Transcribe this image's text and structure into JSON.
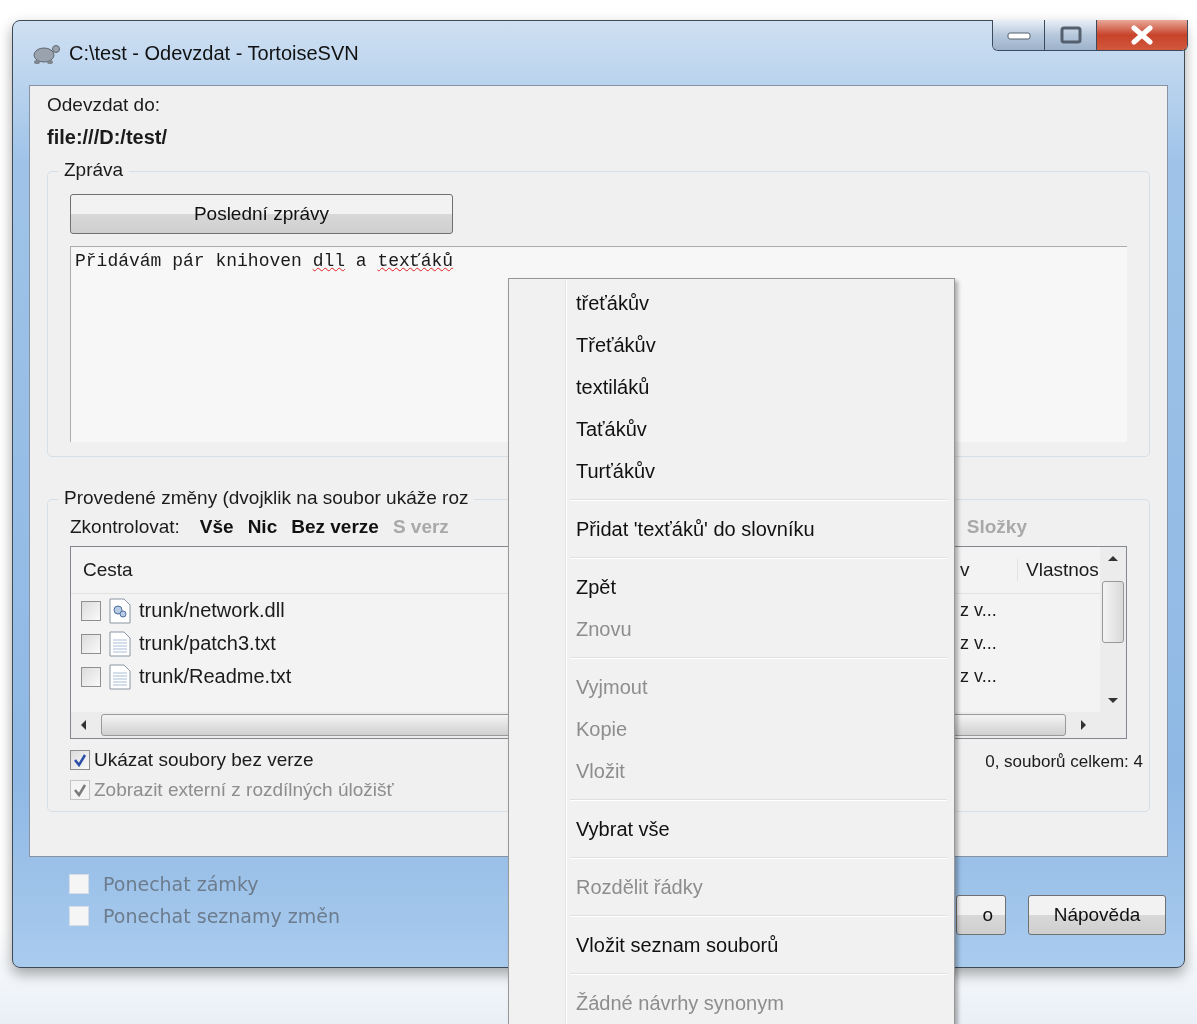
{
  "window": {
    "title": "C:\\test - Odevzdat - TortoiseSVN"
  },
  "commit_to": {
    "label": "Odevzdat do:",
    "url": "file:///D:/test/"
  },
  "message_group": {
    "title": "Zpráva",
    "recent_button": "Poslední zprávy",
    "message": [
      {
        "text": "Přidávám pár knihoven ",
        "misspelled": false
      },
      {
        "text": "dll",
        "misspelled": true
      },
      {
        "text": " a ",
        "misspelled": false
      },
      {
        "text": "texťáků",
        "misspelled": true
      }
    ]
  },
  "changes_group": {
    "title": "Provedené změny (dvojklik na soubor ukáže roz",
    "check_label": "Zkontrolovat:",
    "check_links": [
      {
        "label": "Vše",
        "disabled": false
      },
      {
        "label": "Nic",
        "disabled": false
      },
      {
        "label": "Bez verze",
        "disabled": false
      },
      {
        "label": "S verz",
        "disabled": true
      }
    ],
    "check_links_right": [
      {
        "label": "Složky",
        "disabled": true
      }
    ],
    "list": {
      "columns": [
        "Cesta"
      ],
      "columns_right": [
        "v",
        "Vlastnos"
      ],
      "rows": [
        {
          "path": "trunk/network.dll",
          "kind": "library",
          "checked": false,
          "column_2": "z v..."
        },
        {
          "path": "trunk/patch3.txt",
          "kind": "text",
          "checked": false,
          "column_2": "z v..."
        },
        {
          "path": "trunk/Readme.txt",
          "kind": "text",
          "checked": false,
          "column_2": "z v..."
        }
      ]
    },
    "options": [
      {
        "label": "Ukázat soubory bez verze",
        "checked": true,
        "disabled": false
      },
      {
        "label": "Zobrazit externí z rozdílných úložišť",
        "checked": true,
        "disabled": true
      }
    ],
    "status": "0, souborů celkem: 4"
  },
  "bottom_options": [
    {
      "label": "Ponechat zámky",
      "checked": false,
      "disabled": true
    },
    {
      "label": "Ponechat seznamy změn",
      "checked": false,
      "disabled": true
    }
  ],
  "buttons": [
    "o",
    "Nápověda"
  ],
  "context_menu": {
    "items": [
      {
        "kind": "item",
        "label": "třeťákův",
        "disabled": false
      },
      {
        "kind": "item",
        "label": "Třeťákův",
        "disabled": false
      },
      {
        "kind": "item",
        "label": "textiláků",
        "disabled": false
      },
      {
        "kind": "item",
        "label": "Taťákův",
        "disabled": false
      },
      {
        "kind": "item",
        "label": "Turťákův",
        "disabled": false
      },
      {
        "kind": "separator"
      },
      {
        "kind": "item",
        "label": "Přidat 'texťáků' do slovníku",
        "disabled": false
      },
      {
        "kind": "separator"
      },
      {
        "kind": "item",
        "label": "Zpět",
        "disabled": false
      },
      {
        "kind": "item",
        "label": "Znovu",
        "disabled": true
      },
      {
        "kind": "separator"
      },
      {
        "kind": "item",
        "label": "Vyjmout",
        "disabled": true
      },
      {
        "kind": "item",
        "label": "Kopie",
        "disabled": true
      },
      {
        "kind": "item",
        "label": "Vložit",
        "disabled": true
      },
      {
        "kind": "separator"
      },
      {
        "kind": "item",
        "label": "Vybrat vše",
        "disabled": false
      },
      {
        "kind": "separator"
      },
      {
        "kind": "item",
        "label": "Rozdělit řádky",
        "disabled": true
      },
      {
        "kind": "separator"
      },
      {
        "kind": "item",
        "label": "Vložit seznam souborů",
        "disabled": false
      },
      {
        "kind": "separator"
      },
      {
        "kind": "item",
        "label": "Žádné návrhy synonym",
        "disabled": true
      }
    ]
  }
}
